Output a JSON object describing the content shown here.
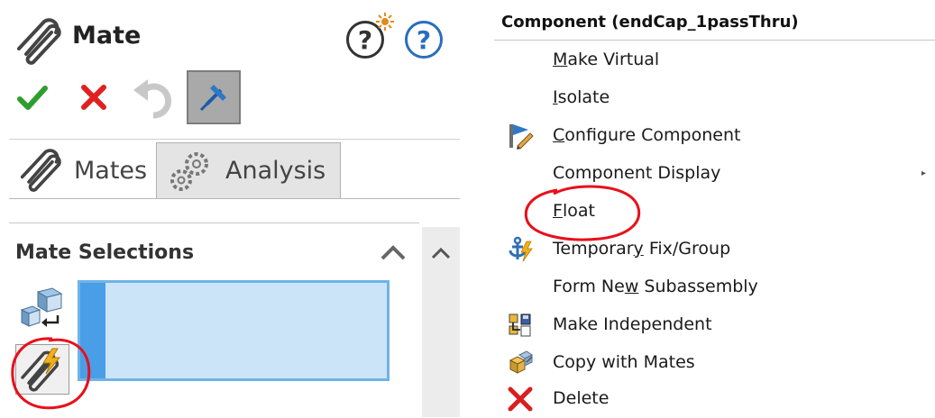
{
  "property_manager": {
    "title": "Mate",
    "help_glyph": "?",
    "tabs": [
      {
        "label": "Mates",
        "icon": "paperclip-icon"
      },
      {
        "label": "Analysis",
        "icon": "gears-icon"
      }
    ],
    "section": {
      "title": "Mate Selections"
    }
  },
  "context_menu": {
    "header": "Component (endCap_1passThru)",
    "items": [
      {
        "pre": "",
        "key": "M",
        "post": "ake Virtual",
        "icon": ""
      },
      {
        "pre": "",
        "key": "I",
        "post": "solate",
        "icon": ""
      },
      {
        "pre": "",
        "key": "C",
        "post": "onfigure Component",
        "icon": "configure-component-icon"
      },
      {
        "pre": "Component Display",
        "key": "",
        "post": "",
        "icon": "",
        "submenu": true
      },
      {
        "pre": "",
        "key": "F",
        "post": "loat",
        "icon": ""
      },
      {
        "pre": "Temporar",
        "key": "y",
        "post": " Fix/Group",
        "icon": "anchor-icon"
      },
      {
        "pre": "Form Ne",
        "key": "w",
        "post": " Subassembly",
        "icon": ""
      },
      {
        "pre": "Make Independent",
        "key": "",
        "post": "",
        "icon": "make-independent-icon"
      },
      {
        "pre": "Copy with Mates",
        "key": "",
        "post": "",
        "icon": "copy-with-mates-icon"
      },
      {
        "pre": "Delete",
        "key": "",
        "post": "",
        "icon": "delete-icon"
      }
    ]
  },
  "colors": {
    "accept": "#2e9e2e",
    "cancel": "#e02020",
    "selection_fill": "#cce4f7",
    "selection_border": "#6fb3e8",
    "annotation": "#e8101a"
  }
}
